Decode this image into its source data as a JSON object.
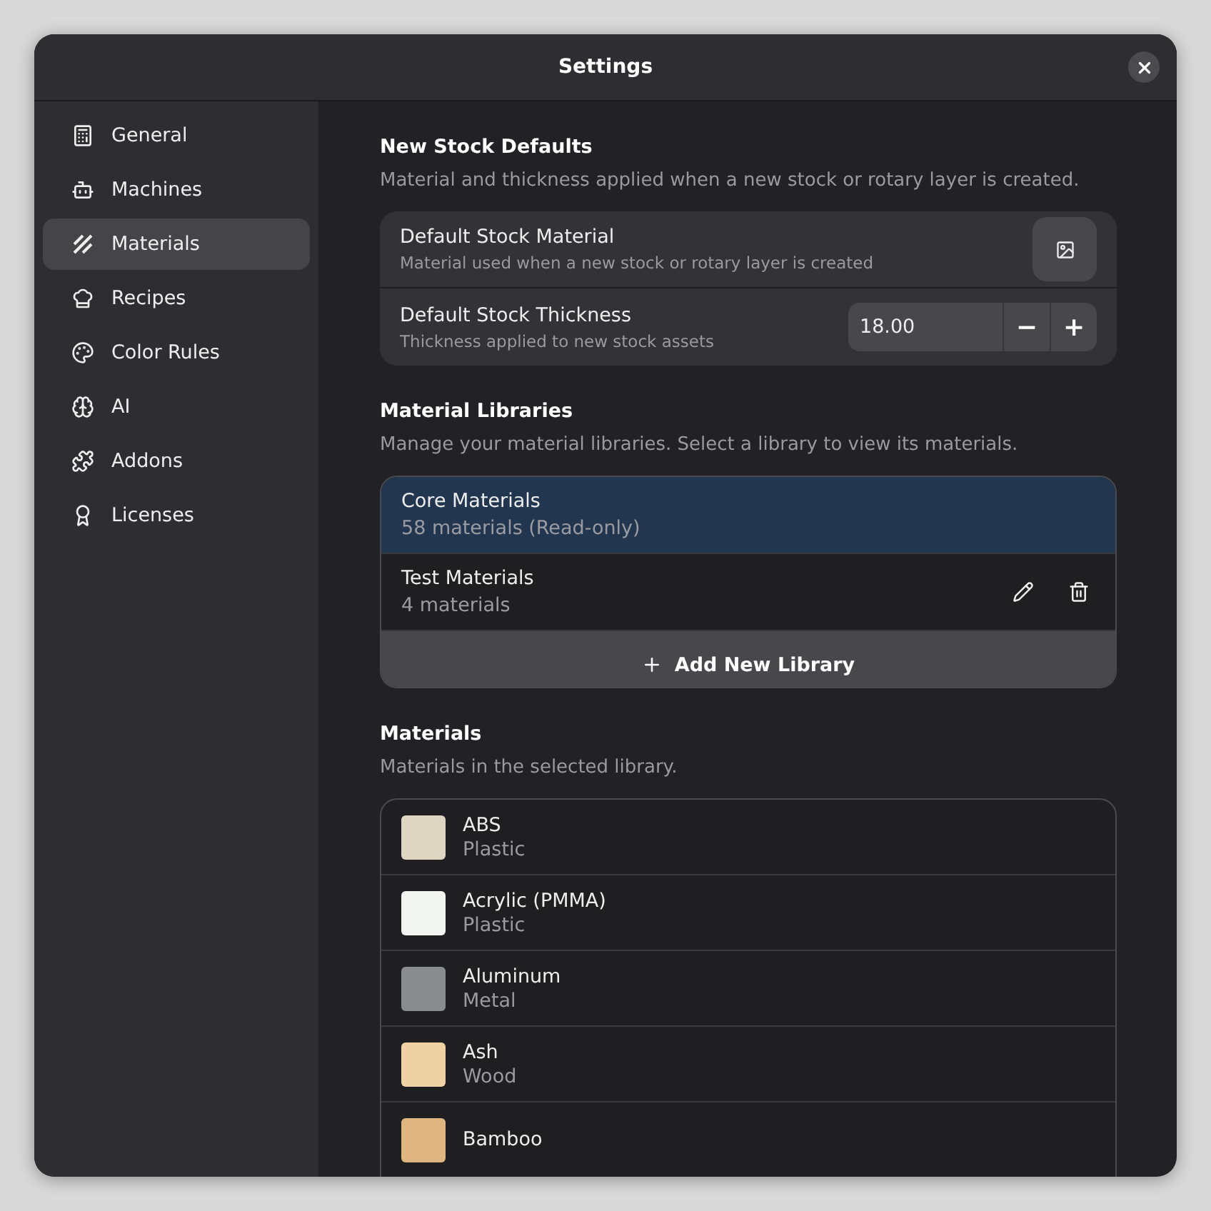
{
  "window": {
    "title": "Settings"
  },
  "sidebar": {
    "items": [
      {
        "label": "General",
        "selected": false
      },
      {
        "label": "Machines",
        "selected": false
      },
      {
        "label": "Materials",
        "selected": true
      },
      {
        "label": "Recipes",
        "selected": false
      },
      {
        "label": "Color Rules",
        "selected": false
      },
      {
        "label": "AI",
        "selected": false
      },
      {
        "label": "Addons",
        "selected": false
      },
      {
        "label": "Licenses",
        "selected": false
      }
    ]
  },
  "stock_defaults": {
    "title": "New Stock Defaults",
    "description": "Material and thickness applied when a new stock or rotary layer is created.",
    "material": {
      "label": "Default Stock Material",
      "hint": "Material used when a new stock or rotary layer is created"
    },
    "thickness": {
      "label": "Default Stock Thickness",
      "hint": "Thickness applied to new stock assets",
      "value": "18.00",
      "decrement": "−",
      "increment": "+"
    }
  },
  "libraries": {
    "title": "Material Libraries",
    "description": "Manage your material libraries. Select a library to view its materials.",
    "items": [
      {
        "name": "Core Materials",
        "detail": "58 materials (Read-only)",
        "selected": true,
        "editable": false
      },
      {
        "name": "Test Materials",
        "detail": "4 materials",
        "selected": false,
        "editable": true
      }
    ],
    "add_button": "Add New Library"
  },
  "materials": {
    "title": "Materials",
    "description": "Materials in the selected library.",
    "items": [
      {
        "name": "ABS",
        "category": "Plastic",
        "color": "#ded6c3"
      },
      {
        "name": "Acrylic (PMMA)",
        "category": "Plastic",
        "color": "#f3f5f0"
      },
      {
        "name": "Aluminum",
        "category": "Metal",
        "color": "#8a8d90"
      },
      {
        "name": "Ash",
        "category": "Wood",
        "color": "#efd2a4"
      },
      {
        "name": "Bamboo",
        "color": "#e0b680"
      }
    ]
  }
}
